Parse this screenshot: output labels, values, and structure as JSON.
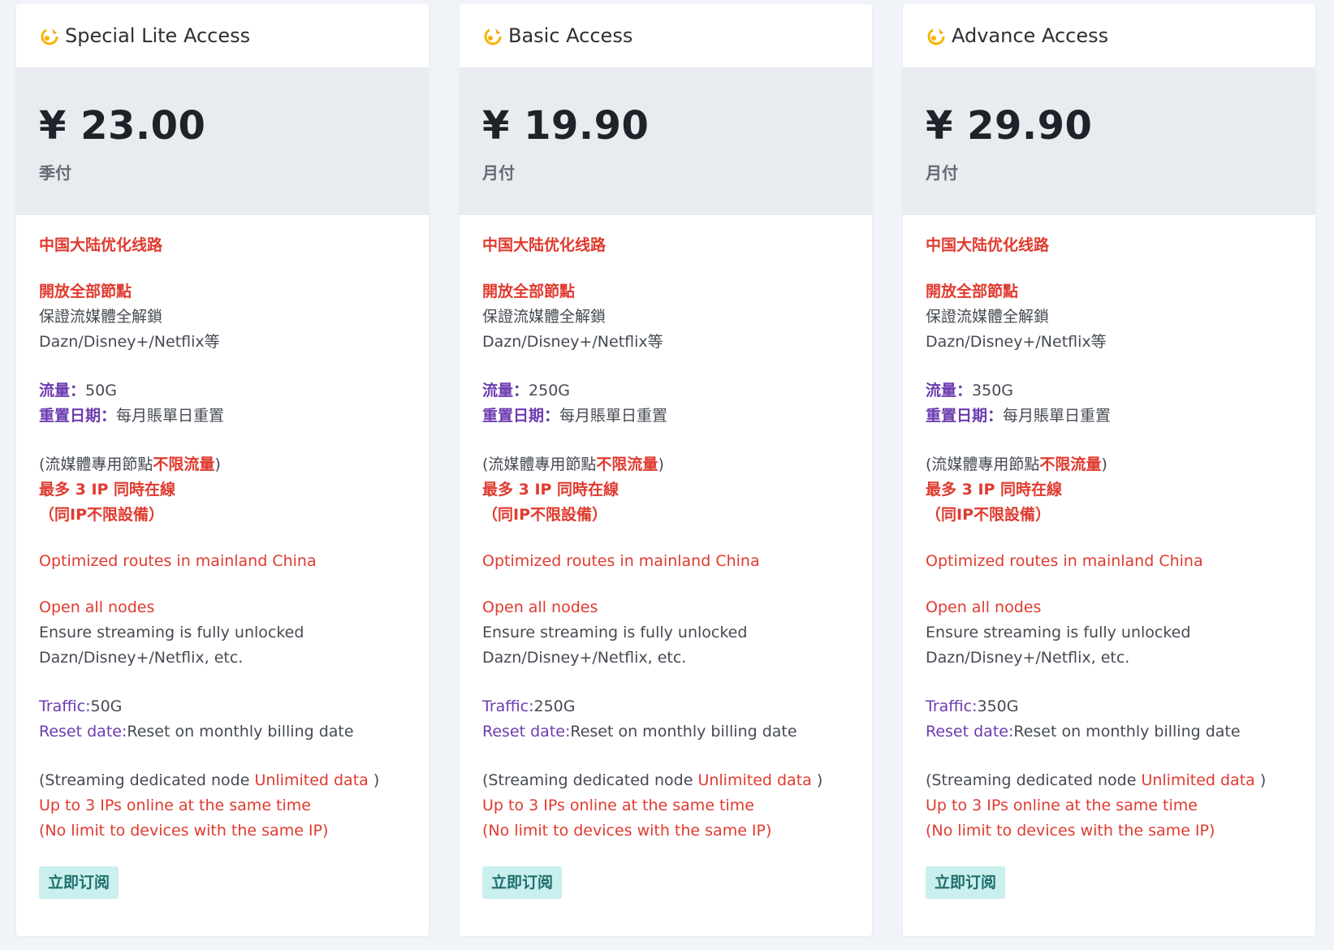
{
  "plans": [
    {
      "title": "Special Lite Access",
      "price": "¥ 23.00",
      "period": "季付",
      "traffic_cn": "50G",
      "traffic_en": "50G"
    },
    {
      "title": "Basic Access",
      "price": "¥ 19.90",
      "period": "月付",
      "traffic_cn": "250G",
      "traffic_en": "250G"
    },
    {
      "title": "Advance Access",
      "price": "¥ 29.90",
      "period": "月付",
      "traffic_cn": "350G",
      "traffic_en": "350G"
    }
  ],
  "features": {
    "cn_route": "中国大陆优化线路",
    "cn_nodes": "開放全部節點",
    "cn_unlock": "保證流媒體全解鎖",
    "cn_services": "Dazn/Disney+/Netflix等",
    "cn_traffic_label": "流量：",
    "cn_reset_label": "重置日期：",
    "cn_reset_value": "每月賬單日重置",
    "cn_stream_prefix": "(流媒體專用節點",
    "cn_stream_unlimited": "不限流量",
    "cn_stream_suffix": ")",
    "cn_ip_limit": "最多 3 IP 同時在線",
    "cn_device": "（同IP不限設備）",
    "en_route": "Optimized routes in mainland China",
    "en_nodes": "Open all nodes",
    "en_unlock": "Ensure streaming is fully unlocked",
    "en_services": "Dazn/Disney+/Netflix, etc.",
    "en_traffic_label": "Traffic:",
    "en_reset_label": "Reset date:",
    "en_reset_value": "Reset on monthly billing date",
    "en_stream_prefix": "(Streaming dedicated node ",
    "en_stream_unlimited": "Unlimited data",
    "en_stream_suffix": " )",
    "en_ip_limit": "Up to 3 IPs online at the same time",
    "en_device": "(No limit to devices with the same IP)"
  },
  "subscribe_label": "立即订阅",
  "icon": "rocket-icon",
  "colors": {
    "background": "#f0f3f8",
    "card": "#ffffff",
    "price_panel": "#e8ebef",
    "highlight_red": "#e03a2f",
    "label_purple": "#6c3bb0",
    "button_bg": "#c9efee",
    "button_text": "#1f6f6c"
  }
}
